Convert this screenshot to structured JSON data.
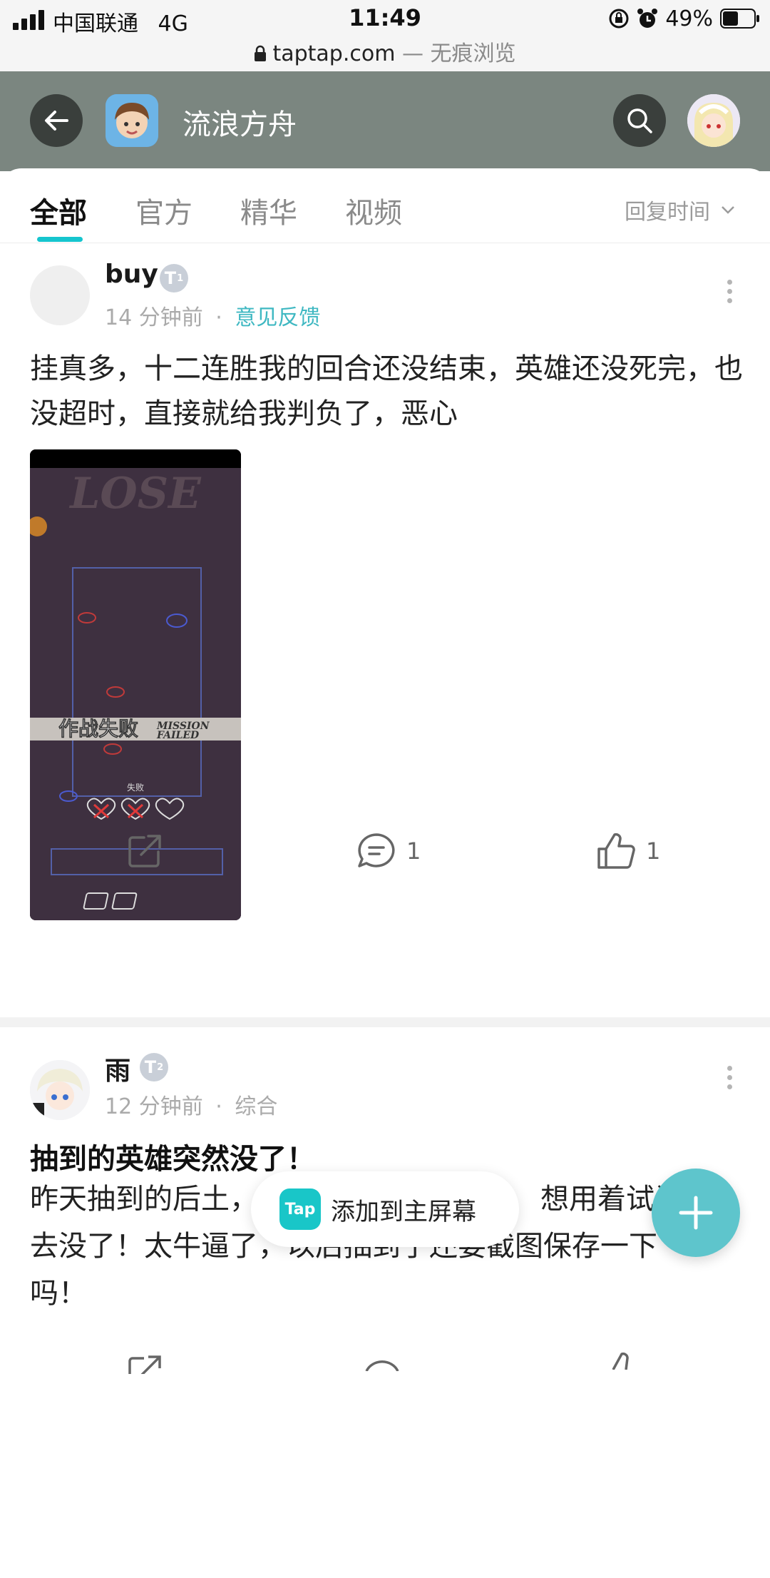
{
  "status_bar": {
    "carrier": "中国联通",
    "network": "4G",
    "time": "11:49",
    "battery": "49%",
    "battery_level": 0.49,
    "url_domain": "taptap.com",
    "url_suffix": " — 无痕浏览"
  },
  "header": {
    "back_icon": "arrow-left-icon",
    "title": "流浪方舟",
    "search_icon": "search-icon"
  },
  "tabs": {
    "items": [
      "全部",
      "官方",
      "精华",
      "视频"
    ],
    "active_index": 0,
    "sort_label": "回复时间",
    "accent_color": "#15c5ce"
  },
  "posts": [
    {
      "author": "buy",
      "badge_letter": "T",
      "badge_level": "1",
      "time": "14 分钟前",
      "separator": "·",
      "category": "意见反馈",
      "body": "挂真多，十二连胜我的回合还没结束，英雄还没死完，也没超时，直接就给我判负了，恶心",
      "image": {
        "lose_text": "LOSE",
        "fail_cn": "作战失败",
        "fail_en_1": "MISSION",
        "fail_en_2": "FAILED",
        "fail_small": "失败"
      },
      "comment_count": "1",
      "like_count": "1"
    },
    {
      "author": "雨",
      "badge_letter": "T",
      "badge_level": "2",
      "time": "12 分钟前",
      "separator": "·",
      "category": "综合",
      "title": "抽到的英雄突然没了！",
      "body_line1_a": "昨天抽到的后土，",
      "body_line1_b": "想用着试试",
      "body_line2": "去没了！太牛逼了，以后抽到了还要截图保存一下",
      "body_line3": "吗！"
    }
  ],
  "toast": {
    "logo_text": "Tap",
    "text": "添加到主屏幕"
  },
  "fab": {
    "icon": "plus-icon"
  }
}
